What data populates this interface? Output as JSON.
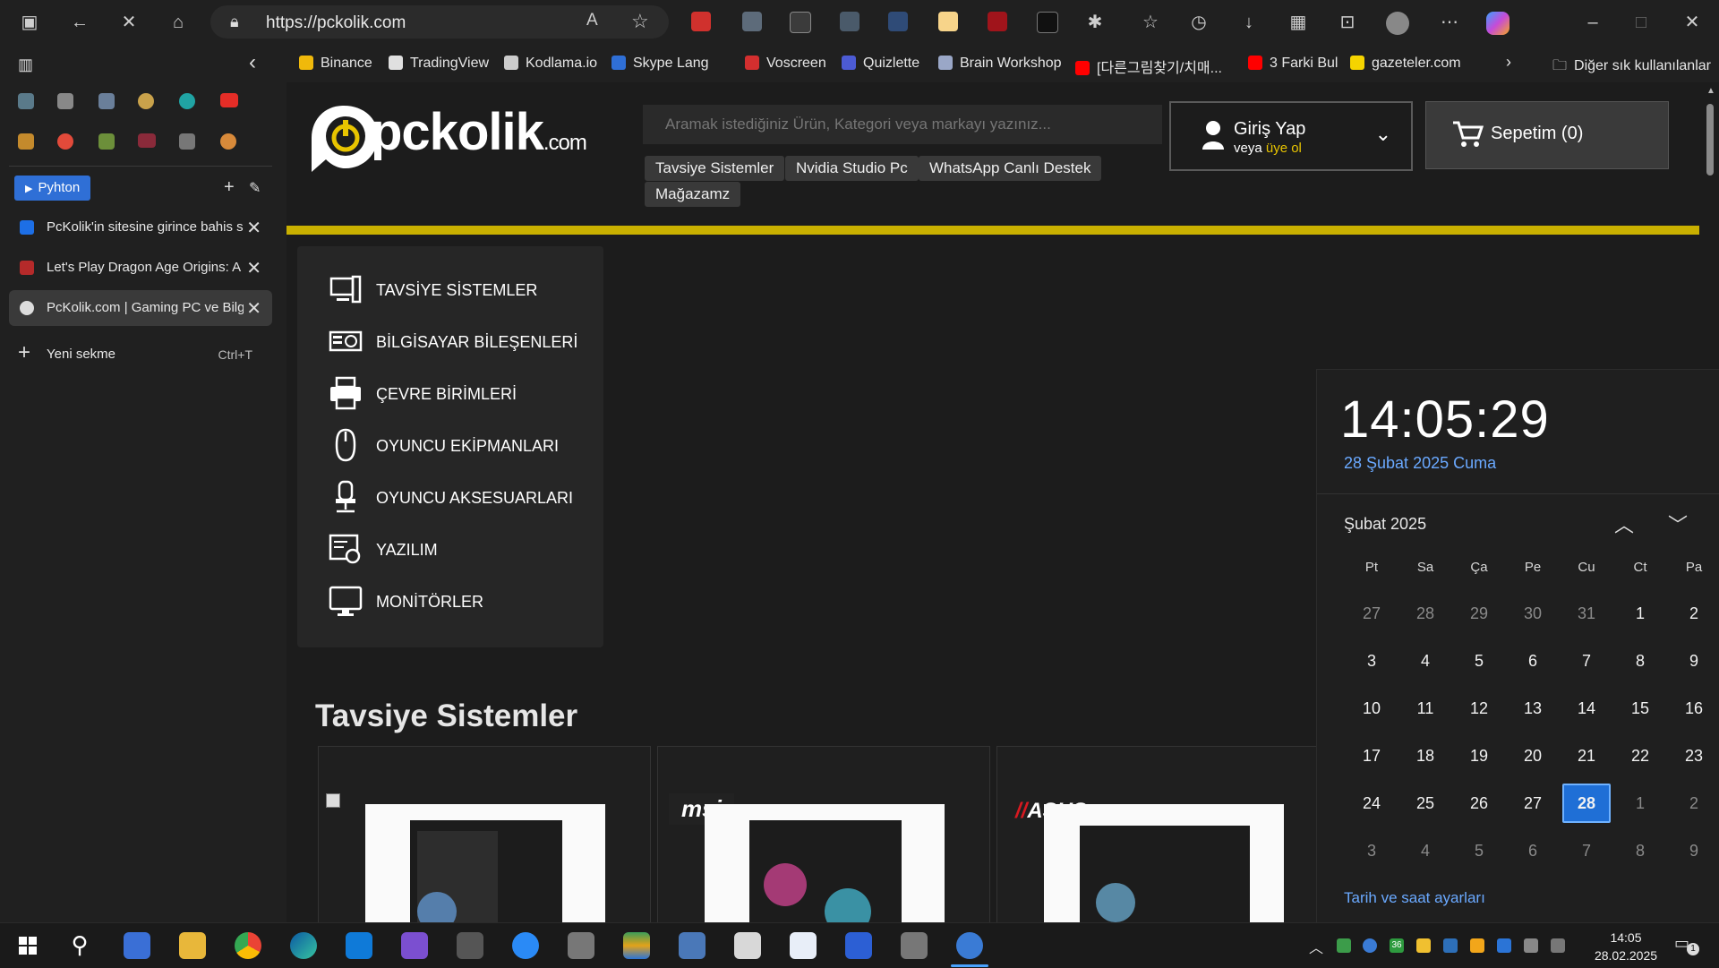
{
  "browser": {
    "url": "https://pckolik.com"
  },
  "bookmarks": [
    {
      "label": "Binance",
      "color": "#f0b90b"
    },
    {
      "label": "TradingView",
      "color": "#e0e0e0"
    },
    {
      "label": "Kodlama.io",
      "color": "#cccccc"
    },
    {
      "label": "Skype Lang",
      "color": "#2f6fd6"
    },
    {
      "label": "Voscreen",
      "color": "#d32f2f"
    },
    {
      "label": "Quizlette",
      "color": "#4c5bd4"
    },
    {
      "label": "Brain Workshop",
      "color": "#9aa7c7"
    },
    {
      "label": "[다른그림찾기/치매...",
      "color": "#ff0000"
    },
    {
      "label": "3 Farki Bul",
      "color": "#ff0000"
    },
    {
      "label": "gazeteler.com",
      "color": "#f5d400"
    }
  ],
  "bookmarks_other": "Diğer sık kullanılanlar",
  "sidebar": {
    "group_label": "Pyhton",
    "tabs": [
      {
        "title": "PcKolik'in sitesine girince bahis s",
        "color": "#1d6fe6"
      },
      {
        "title": "Let's Play Dragon Age Origins: A",
        "color": "#b52a2a"
      },
      {
        "title": "PcKolik.com | Gaming PC ve Bilgi",
        "color": "#dddddd"
      }
    ],
    "new_tab_label": "Yeni sekme",
    "new_tab_shortcut": "Ctrl+T"
  },
  "site": {
    "logo_text": "pckolik",
    "logo_suffix": ".com",
    "search_placeholder": "Aramak istediğiniz Ürün, Kategori veya markayı yazınız...",
    "chips": [
      "Tavsiye Sistemler",
      "Nvidia Studio Pc",
      "WhatsApp Canlı Destek",
      "Mağazamz"
    ],
    "login_title": "Giriş Yap",
    "login_sub_prefix": "veya",
    "login_sub_link": "üye ol",
    "cart_label": "Sepetim (0)",
    "categories": [
      "TAVSİYE SİSTEMLER",
      "BİLGİSAYAR BİLEŞENLERİ",
      "ÇEVRE BİRİMLERİ",
      "OYUNCU EKİPMANLARI",
      "OYUNCU AKSESUARLARI",
      "YAZILIM",
      "MONİTÖRLER"
    ],
    "section_title": "Tavsiye Sistemler",
    "card_brands": [
      "",
      "msi",
      "ASUS"
    ]
  },
  "calendar": {
    "time": "14:05:29",
    "date_long": "28 Şubat 2025 Cuma",
    "month_label": "Şubat 2025",
    "weekdays": [
      "Pt",
      "Sa",
      "Ça",
      "Pe",
      "Cu",
      "Ct",
      "Pa"
    ],
    "weeks": [
      [
        "27",
        "28",
        "29",
        "30",
        "31",
        "1",
        "2"
      ],
      [
        "3",
        "4",
        "5",
        "6",
        "7",
        "8",
        "9"
      ],
      [
        "10",
        "11",
        "12",
        "13",
        "14",
        "15",
        "16"
      ],
      [
        "17",
        "18",
        "19",
        "20",
        "21",
        "22",
        "23"
      ],
      [
        "24",
        "25",
        "26",
        "27",
        "28",
        "1",
        "2"
      ],
      [
        "3",
        "4",
        "5",
        "6",
        "7",
        "8",
        "9"
      ]
    ],
    "today": "28",
    "settings_link": "Tarih ve saat ayarları"
  },
  "taskbar": {
    "time": "14:05",
    "date": "28.02.2025",
    "notification_count": "1",
    "tray_badge": "36"
  }
}
